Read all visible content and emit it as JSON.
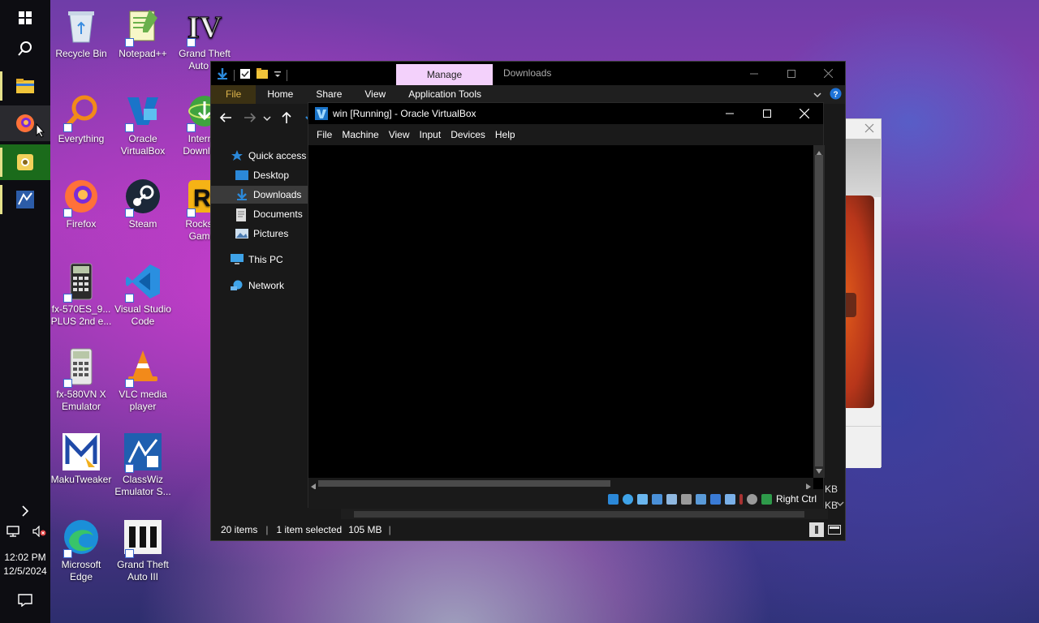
{
  "taskbar": {
    "clock_time": "12:02 PM",
    "clock_date": "12/5/2024",
    "icons": [
      "windows-start-icon",
      "search-icon",
      "file-explorer-icon",
      "firefox-icon",
      "app-yellow-icon",
      "classwiz-icon"
    ]
  },
  "desktop": {
    "icons": [
      {
        "label": "Recycle Bin"
      },
      {
        "label": "Notepad++"
      },
      {
        "label": "Grand Theft Auto IV"
      },
      {
        "label": "Everything"
      },
      {
        "label": "Oracle VirtualBox"
      },
      {
        "label": "Internet Download"
      },
      {
        "label": "Firefox"
      },
      {
        "label": "Steam"
      },
      {
        "label": "Rockstar Games"
      },
      {
        "label": "fx-570ES_9... PLUS 2nd e..."
      },
      {
        "label": "Visual Studio Code"
      },
      {
        "label": "fx-580VN X Emulator"
      },
      {
        "label": "VLC media player"
      },
      {
        "label": "MakuTweaker"
      },
      {
        "label": "ClassWiz Emulator S..."
      },
      {
        "label": "Microsoft Edge"
      },
      {
        "label": "Grand Theft Auto III"
      }
    ]
  },
  "explorer": {
    "title": "Downloads",
    "context_tab": "Manage",
    "ribbon_tabs": [
      "File",
      "Home",
      "Share",
      "View",
      "Application Tools"
    ],
    "nav": {
      "quick_access": "Quick access",
      "desktop": "Desktop",
      "downloads": "Downloads",
      "documents": "Documents",
      "pictures": "Pictures",
      "this_pc": "This PC",
      "network": "Network"
    },
    "status": {
      "items": "20 items",
      "selected": "1 item selected",
      "size": "105 MB"
    },
    "partial_text": [
      "KB",
      "KB"
    ]
  },
  "vbox": {
    "title": "win [Running] - Oracle VirtualBox",
    "menu": [
      "File",
      "Machine",
      "View",
      "Input",
      "Devices",
      "Help"
    ],
    "host_key": "Right Ctrl"
  },
  "colors": {
    "accent_file_tab": "#ddb44c",
    "manage_tab_bg": "#f3d1fb",
    "folder_blue": "#2b88d8"
  }
}
